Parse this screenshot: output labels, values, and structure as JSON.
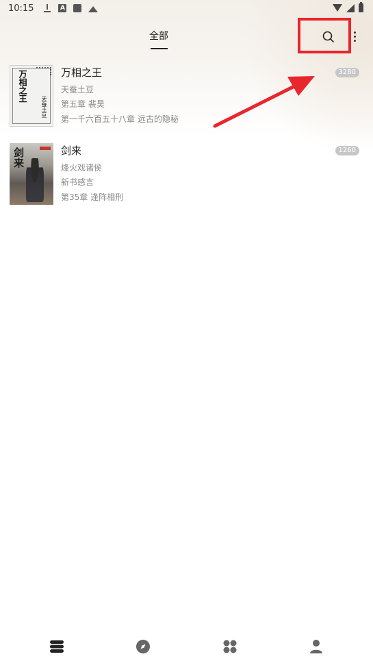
{
  "status_bar": {
    "time": "10:15",
    "icons": [
      "download-icon",
      "a-icon",
      "square-icon",
      "mountain-icon"
    ],
    "right_icons": [
      "wifi-icon",
      "signal-icon",
      "battery-icon"
    ]
  },
  "header": {
    "tab_label": "全部",
    "search_icon": "search-icon",
    "more_icon": "more-vertical-icon"
  },
  "annotation": {
    "highlight_color": "#e8262c"
  },
  "books": [
    {
      "title": "万相之王",
      "author": "天蚕土豆",
      "read_chapter": "第五章 裴昊",
      "latest_chapter": "第一千六百五十八章 远古的隐秘",
      "unread_count": "3280",
      "cover_title": "万相之王",
      "cover_author": "天蚕土豆"
    },
    {
      "title": "剑来",
      "author": "烽火戏诸侯",
      "read_chapter": "新书感言",
      "latest_chapter": "第35章 逢阵相刑",
      "unread_count": "1260",
      "cover_title": "剑来"
    }
  ],
  "bottom_nav": [
    {
      "icon": "bookshelf-icon"
    },
    {
      "icon": "compass-icon"
    },
    {
      "icon": "apps-icon"
    },
    {
      "icon": "profile-icon"
    }
  ]
}
